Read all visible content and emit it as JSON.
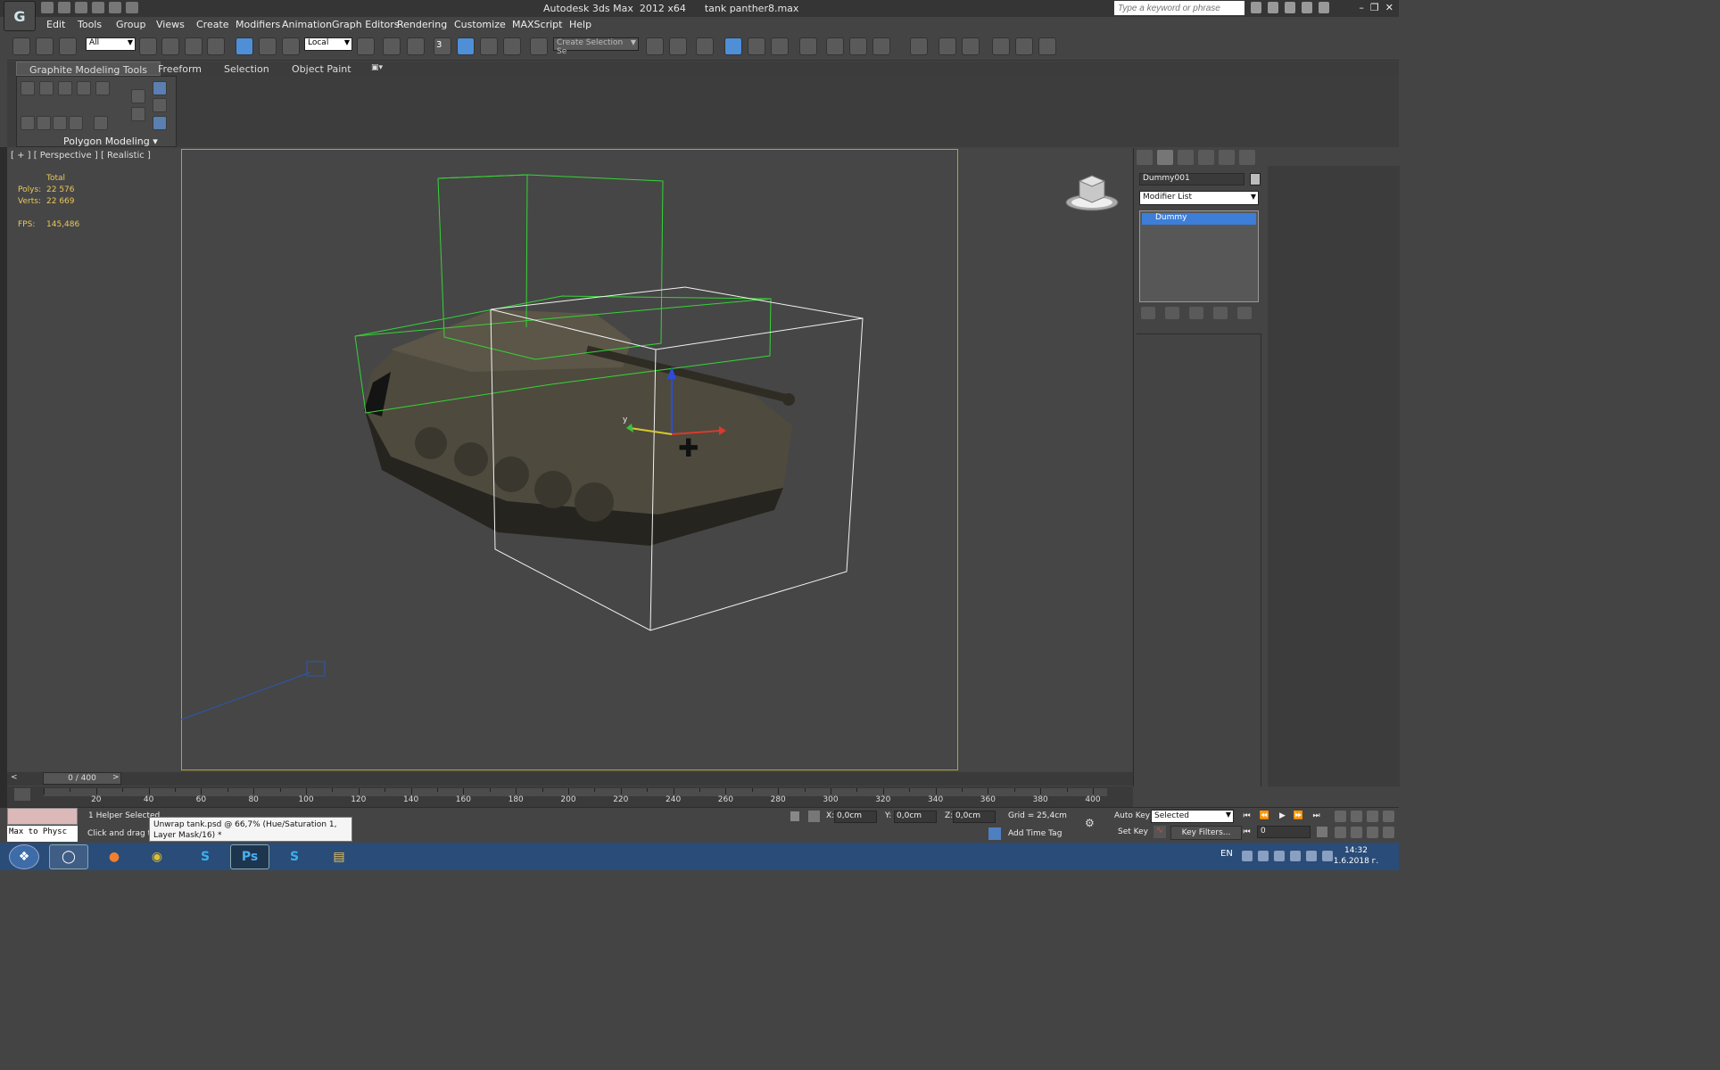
{
  "window": {
    "app_title": "Autodesk 3ds Max  2012 x64",
    "file_name": "tank panther8.max",
    "search_placeholder": "Type a keyword or phrase",
    "logo_text": "G"
  },
  "menu": [
    "Edit",
    "Tools",
    "Group",
    "Views",
    "Create",
    "Modifiers",
    "Animation",
    "Graph Editors",
    "Rendering",
    "Customize",
    "MAXScript",
    "Help"
  ],
  "toolbar": {
    "selection_filter": "All",
    "ref_coord_system": "Local",
    "named_selection_placeholder": "Create Selection Se",
    "snap_value": "3"
  },
  "ribbon": {
    "tabs": [
      "Graphite Modeling Tools",
      "Freeform",
      "Selection",
      "Object Paint"
    ],
    "active_tab": "Graphite Modeling Tools",
    "panel_label": "Polygon Modeling"
  },
  "viewport": {
    "label": "[ + ] [ Perspective ] [ Realistic ]",
    "stats": {
      "header": "Total",
      "polys_label": "Polys:",
      "polys_value": "22 576",
      "verts_label": "Verts:",
      "verts_value": "22 669",
      "fps_label": "FPS:",
      "fps_value": "145,486"
    }
  },
  "command_panel": {
    "object_name": "Dummy001",
    "modifier_list": "Modifier List",
    "stack_items": [
      "Dummy"
    ]
  },
  "timeline": {
    "frame_readout": "0 / 400",
    "prev": "<",
    "next": ">",
    "ticks": [
      20,
      40,
      60,
      80,
      100,
      120,
      140,
      160,
      180,
      200,
      220,
      240,
      260,
      280,
      300,
      320,
      340,
      360,
      380,
      400
    ]
  },
  "status": {
    "maxscript_output": "Max to Physc",
    "selection_info": "1 Helper Selected",
    "prompt": "Click and drag to s",
    "tooltip": "Unwrap tank.psd @ 66,7% (Hue/Saturation 1, Layer Mask/16) *",
    "x_label": "X:",
    "x_value": "0,0cm",
    "y_label": "Y:",
    "y_value": "0,0cm",
    "z_label": "Z:",
    "z_value": "0,0cm",
    "grid": "Grid = 25,4cm",
    "add_time_tag": "Add Time Tag",
    "auto_key": "Auto Key",
    "set_key": "Set Key",
    "key_mode": "Selected",
    "key_filters": "Key Filters...",
    "current_frame": "0"
  },
  "taskbar": {
    "language": "EN",
    "time": "14:32",
    "date": "1.6.2018 г."
  }
}
